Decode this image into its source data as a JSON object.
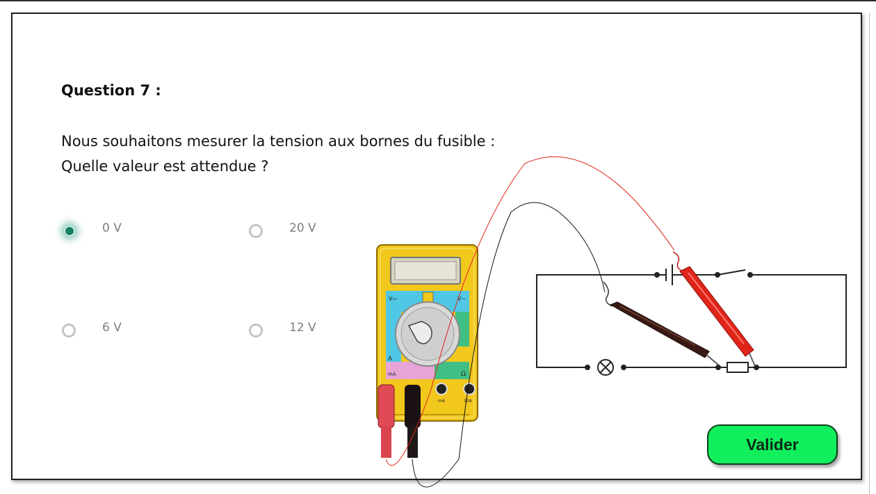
{
  "question": {
    "title": "Question 7 :",
    "text_line1": "Nous souhaitons mesurer la tension aux bornes du fusible :",
    "text_line2": "Quelle valeur est attendue ?"
  },
  "options": [
    {
      "label": "0 V",
      "selected": true
    },
    {
      "label": "20 V",
      "selected": false
    },
    {
      "label": "6 V",
      "selected": false
    },
    {
      "label": "12 V",
      "selected": false
    }
  ],
  "submit_label": "Valider",
  "colors": {
    "selected_radio": "#16805f",
    "submit_button": "#12ef5c",
    "multimeter_body": "#f2c81d",
    "probe_red": "#e0251b",
    "probe_black": "#3a1a14"
  },
  "multimeter": {
    "dial_labels": {
      "dc_voltage": "V⎓",
      "ac_voltage": "V~",
      "current": "A",
      "milliamps": "mA",
      "ohm": "Ω"
    },
    "jacks": {
      "ma": "mA",
      "ten_a": "10A"
    }
  },
  "icons": [
    "radio-button",
    "multimeter",
    "test-probe",
    "battery",
    "lamp",
    "fuse",
    "switch"
  ]
}
